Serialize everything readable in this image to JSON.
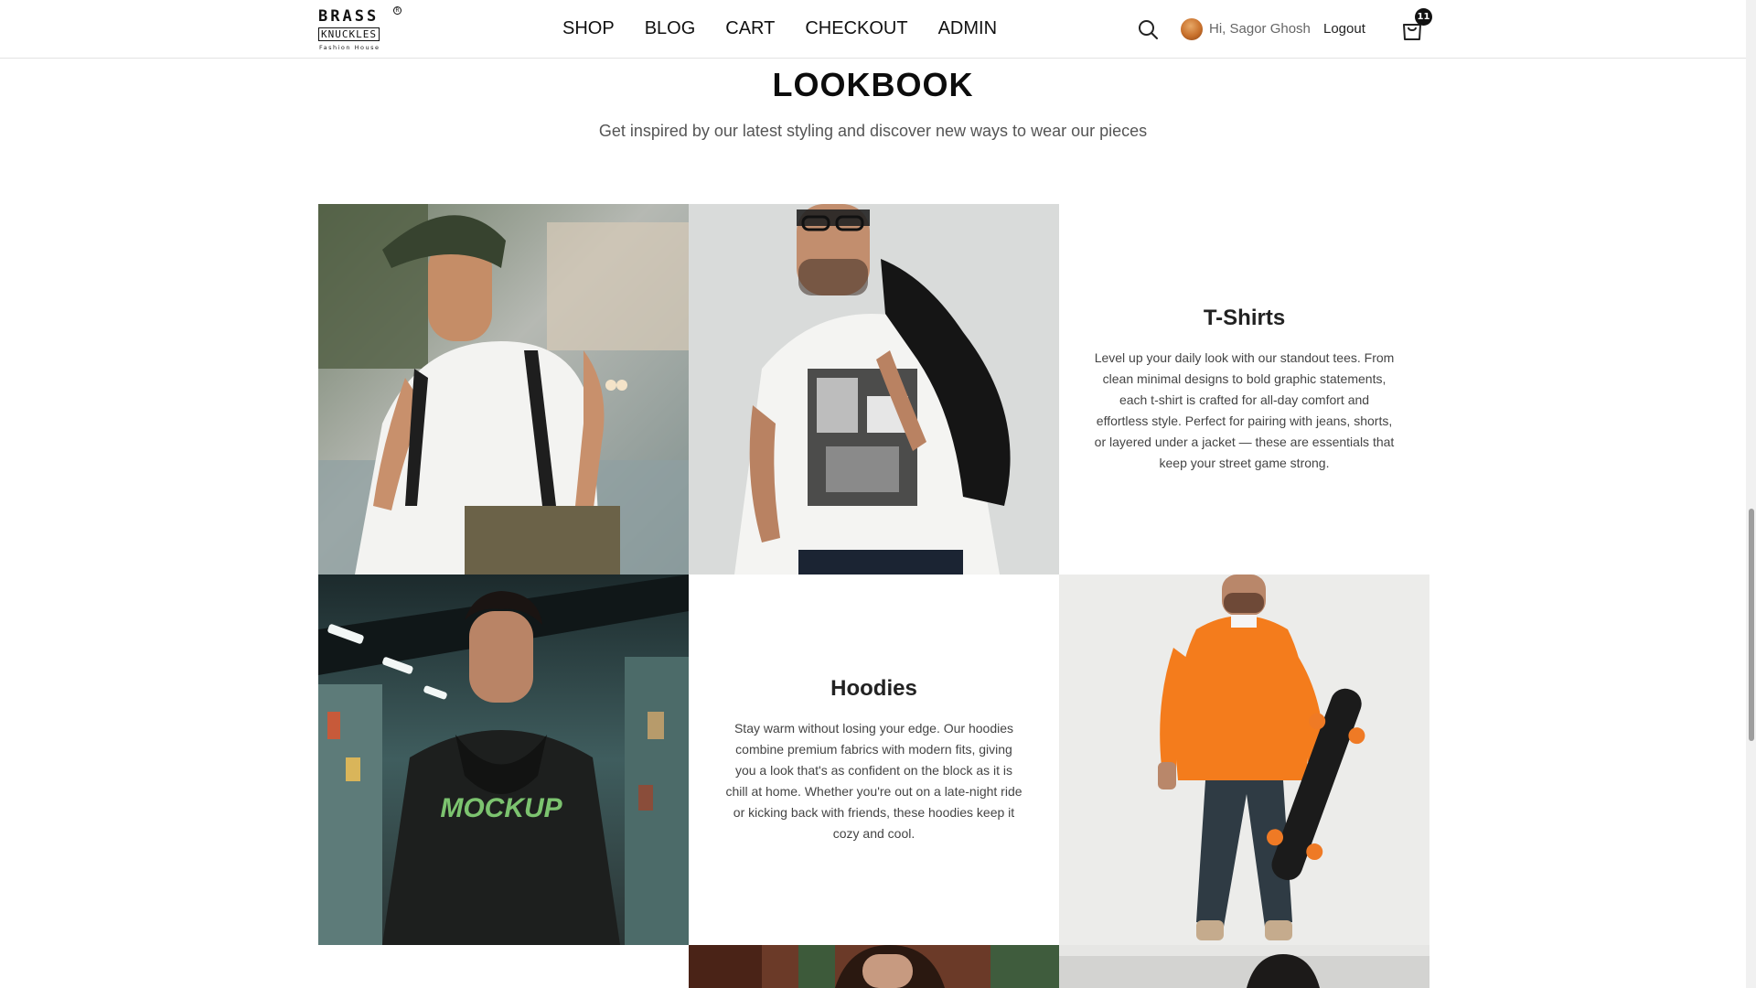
{
  "brand": {
    "line1": "BRASS",
    "line2": "KNUCKLES",
    "tagline": "Fashion House",
    "reg_mark": "R"
  },
  "nav": {
    "items": [
      {
        "label": "SHOP"
      },
      {
        "label": "BLOG"
      },
      {
        "label": "CART"
      },
      {
        "label": "CHECKOUT"
      },
      {
        "label": "ADMIN"
      }
    ]
  },
  "user": {
    "greeting": "Hi, Sagor Ghosh",
    "logout_label": "Logout"
  },
  "cart": {
    "count": "11"
  },
  "icons": {
    "search": "search-icon",
    "cart": "shopping-bag-icon",
    "avatar": "user-avatar"
  },
  "lookbook": {
    "title": "LOOKBOOK",
    "subtitle": "Get inspired by our latest styling and discover new ways to wear our pieces",
    "categories": [
      {
        "title": "T-Shirts",
        "description": "Level up your daily look with our standout tees. From clean minimal designs to bold graphic statements, each t-shirt is crafted for all-day comfort and effortless style. Perfect for pairing with jeans, shorts, or layered under a jacket — these are essentials that keep your street game strong."
      },
      {
        "title": "Hoodies",
        "description": "Stay warm without losing your edge. Our hoodies combine premium fabrics with modern fits, giving you a look that's as confident on the block as it is chill at home. Whether you're out on a late-night ride or kicking back with friends, these hoodies keep it cozy and cool."
      }
    ],
    "photo_print_text": "MOCKUP"
  },
  "colors": {
    "text_primary": "#111111",
    "text_muted": "#555555",
    "badge": "#111111",
    "hoodie_orange": "#f47c1c"
  }
}
